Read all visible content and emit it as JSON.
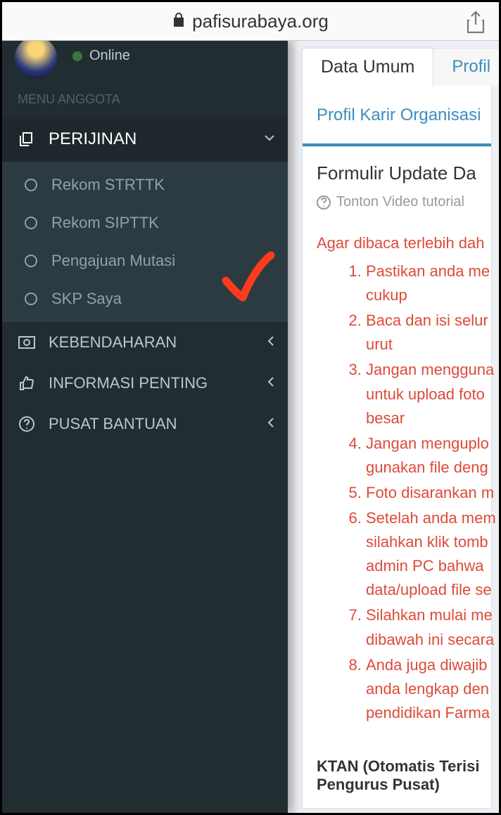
{
  "browser": {
    "url": "pafisurabaya.org"
  },
  "sidebar": {
    "status": "Online",
    "menu_header": "MENU ANGGOTA",
    "perijinan": {
      "label": "PERIJINAN",
      "items": [
        "Rekom STRTTK",
        "Rekom SIPTTK",
        "Pengajuan Mutasi",
        "SKP Saya"
      ]
    },
    "others": [
      {
        "label": "KEBENDAHARAN"
      },
      {
        "label": "INFORMASI PENTING"
      },
      {
        "label": "PUSAT BANTUAN"
      }
    ]
  },
  "tabs": {
    "data_umum": "Data Umum",
    "profil": "Profil ",
    "karir": "Profil Karir Organisasi"
  },
  "form": {
    "title": "Formulir Update Da",
    "tutorial": "Tonton Video tutorial",
    "warning_intro": "Agar dibaca terlebih dah",
    "items": [
      "Pastikan anda me<br>cukup",
      "Baca dan isi selur<br>urut",
      "Jangan mengguna<br>untuk upload foto<br>besar",
      "Jangan menguplo<br>gunakan file deng",
      "Foto disarankan m",
      "Setelah anda mem<br>silahkan klik tomb<br>admin PC bahwa <br>data/upload file se",
      "Silahkan mulai me<br>dibawah ini secara",
      "Anda juga diwajib<br>anda lengkap den<br>pendidikan Farma"
    ],
    "ktan": "KTAN (Otomatis Terisi ",
    "ktan2": "Pengurus Pusat)"
  }
}
